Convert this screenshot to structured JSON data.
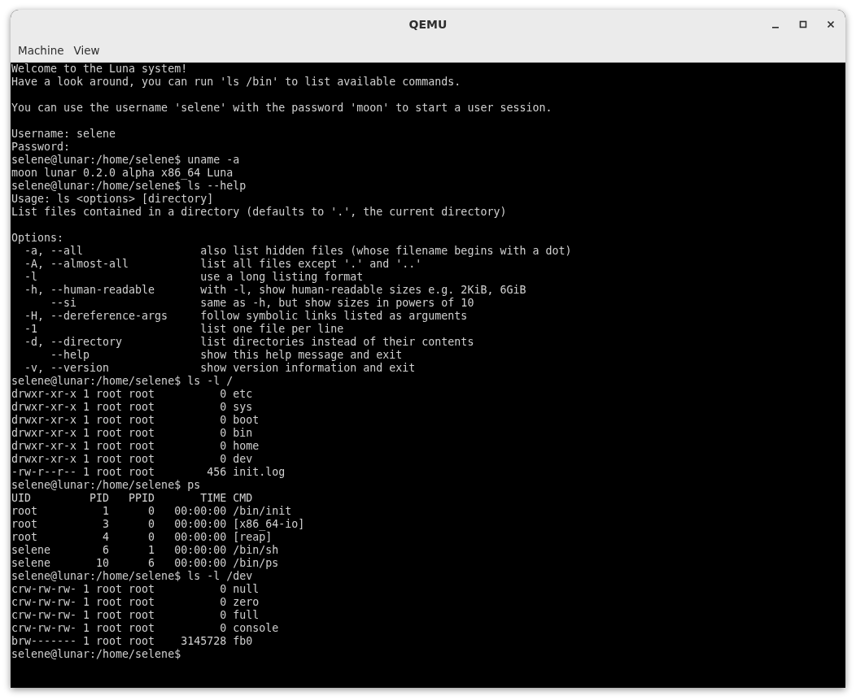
{
  "window": {
    "title": "QEMU"
  },
  "menu": [
    "Machine",
    "View"
  ],
  "console": {
    "blocks": [
      [
        "Welcome to the Luna system!",
        "Have a look around, you can run 'ls /bin' to list available commands."
      ],
      [
        "You can use the username 'selene' with the password 'moon' to start a user session."
      ],
      [
        "Username: selene",
        "Password:",
        "selene@lunar:/home/selene$ uname -a",
        "moon lunar 0.2.0 alpha x86_64 Luna",
        "selene@lunar:/home/selene$ ls --help",
        "Usage: ls <options> [directory]",
        "List files contained in a directory (defaults to '.', the current directory)"
      ],
      [
        "Options:",
        "  -a, --all                  also list hidden files (whose filename begins with a dot)",
        "  -A, --almost-all           list all files except '.' and '..'",
        "  -l                         use a long listing format",
        "  -h, --human-readable       with -l, show human-readable sizes e.g. 2KiB, 6GiB",
        "      --si                   same as -h, but show sizes in powers of 10",
        "  -H, --dereference-args     follow symbolic links listed as arguments",
        "  -1                         list one file per line",
        "  -d, --directory            list directories instead of their contents",
        "      --help                 show this help message and exit",
        "  -v, --version              show version information and exit",
        "selene@lunar:/home/selene$ ls -l /",
        "drwxr-xr-x 1 root root          0 etc",
        "drwxr-xr-x 1 root root          0 sys",
        "drwxr-xr-x 1 root root          0 boot",
        "drwxr-xr-x 1 root root          0 bin",
        "drwxr-xr-x 1 root root          0 home",
        "drwxr-xr-x 1 root root          0 dev",
        "-rw-r--r-- 1 root root        456 init.log",
        "selene@lunar:/home/selene$ ps",
        "UID         PID   PPID       TIME CMD",
        "root          1      0   00:00:00 /bin/init",
        "root          3      0   00:00:00 [x86_64-io]",
        "root          4      0   00:00:00 [reap]",
        "selene        6      1   00:00:00 /bin/sh",
        "selene       10      6   00:00:00 /bin/ps",
        "selene@lunar:/home/selene$ ls -l /dev",
        "crw-rw-rw- 1 root root          0 null",
        "crw-rw-rw- 1 root root          0 zero",
        "crw-rw-rw- 1 root root          0 full",
        "crw-rw-rw- 1 root root          0 console",
        "brw------- 1 root root    3145728 fb0",
        "selene@lunar:/home/selene$"
      ]
    ]
  }
}
